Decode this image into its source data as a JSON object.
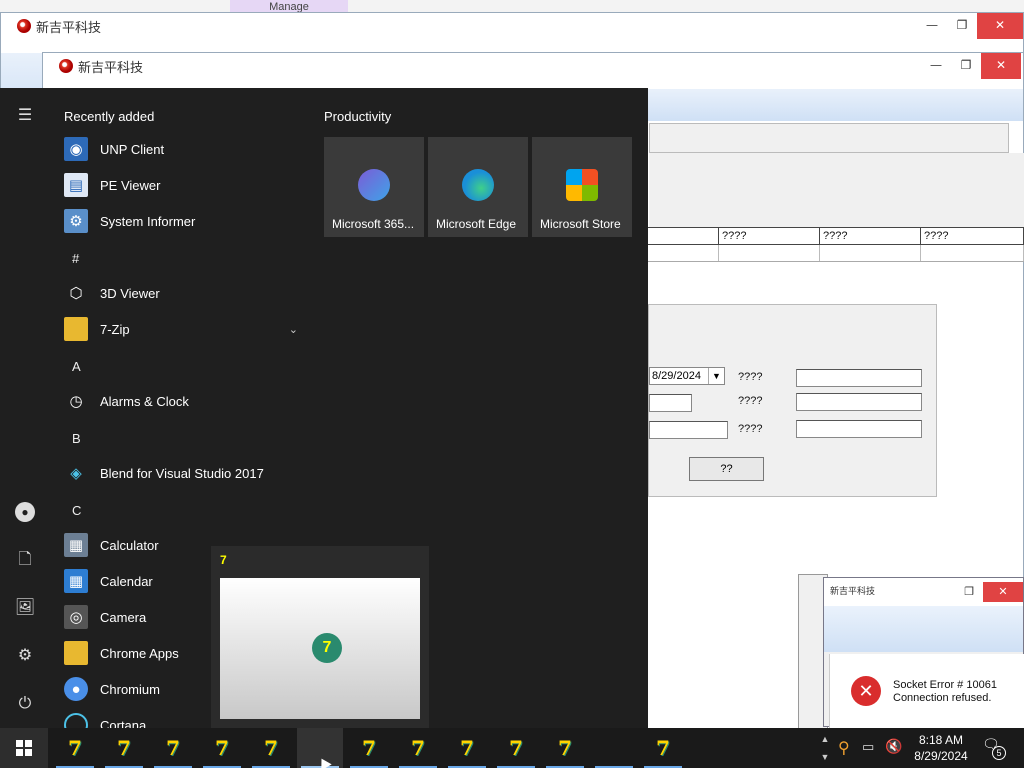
{
  "background": {
    "top_tab": "Manage",
    "window_title": "新吉平科技",
    "inner_window_title": "新吉平科技",
    "grid_headers": [
      "????",
      "????",
      "????"
    ],
    "form": {
      "date_value": "8/29/2024",
      "label1": "????",
      "label2": "????",
      "label3": "????",
      "button": "??"
    }
  },
  "error_window": {
    "title": "新吉平科技",
    "message_line1": "Socket Error # 10061",
    "message_line2": "Connection refused."
  },
  "start_menu": {
    "recent_header": "Recently added",
    "productivity_header": "Productivity",
    "apps": [
      {
        "label": "UNP Client",
        "icon": "unp-client-icon"
      },
      {
        "label": "PE Viewer",
        "icon": "pe-viewer-icon"
      },
      {
        "label": "System Informer",
        "icon": "system-informer-icon"
      },
      {
        "label": "3D Viewer",
        "icon": "cube-icon"
      },
      {
        "label": "7-Zip",
        "icon": "folder-icon"
      },
      {
        "label": "Alarms & Clock",
        "icon": "clock-icon"
      },
      {
        "label": "Blend for Visual Studio 2017",
        "icon": "blend-icon"
      },
      {
        "label": "Calculator",
        "icon": "calculator-icon"
      },
      {
        "label": "Calendar",
        "icon": "calendar-icon"
      },
      {
        "label": "Camera",
        "icon": "camera-icon"
      },
      {
        "label": "Chrome Apps",
        "icon": "folder-icon"
      },
      {
        "label": "Chromium",
        "icon": "chromium-icon"
      },
      {
        "label": "Cortana",
        "icon": "cortana-icon"
      }
    ],
    "letters": [
      "#",
      "A",
      "B",
      "C"
    ],
    "tiles": [
      {
        "label": "Microsoft 365...",
        "color": "#7b5cd6"
      },
      {
        "label": "Microsoft Edge",
        "color": "#1a8fd8"
      },
      {
        "label": "Microsoft Store",
        "color": "#f25022"
      }
    ]
  },
  "taskbar": {
    "time": "8:18 AM",
    "date": "8/29/2024",
    "app_glyph": "7",
    "notification_count": "5"
  }
}
